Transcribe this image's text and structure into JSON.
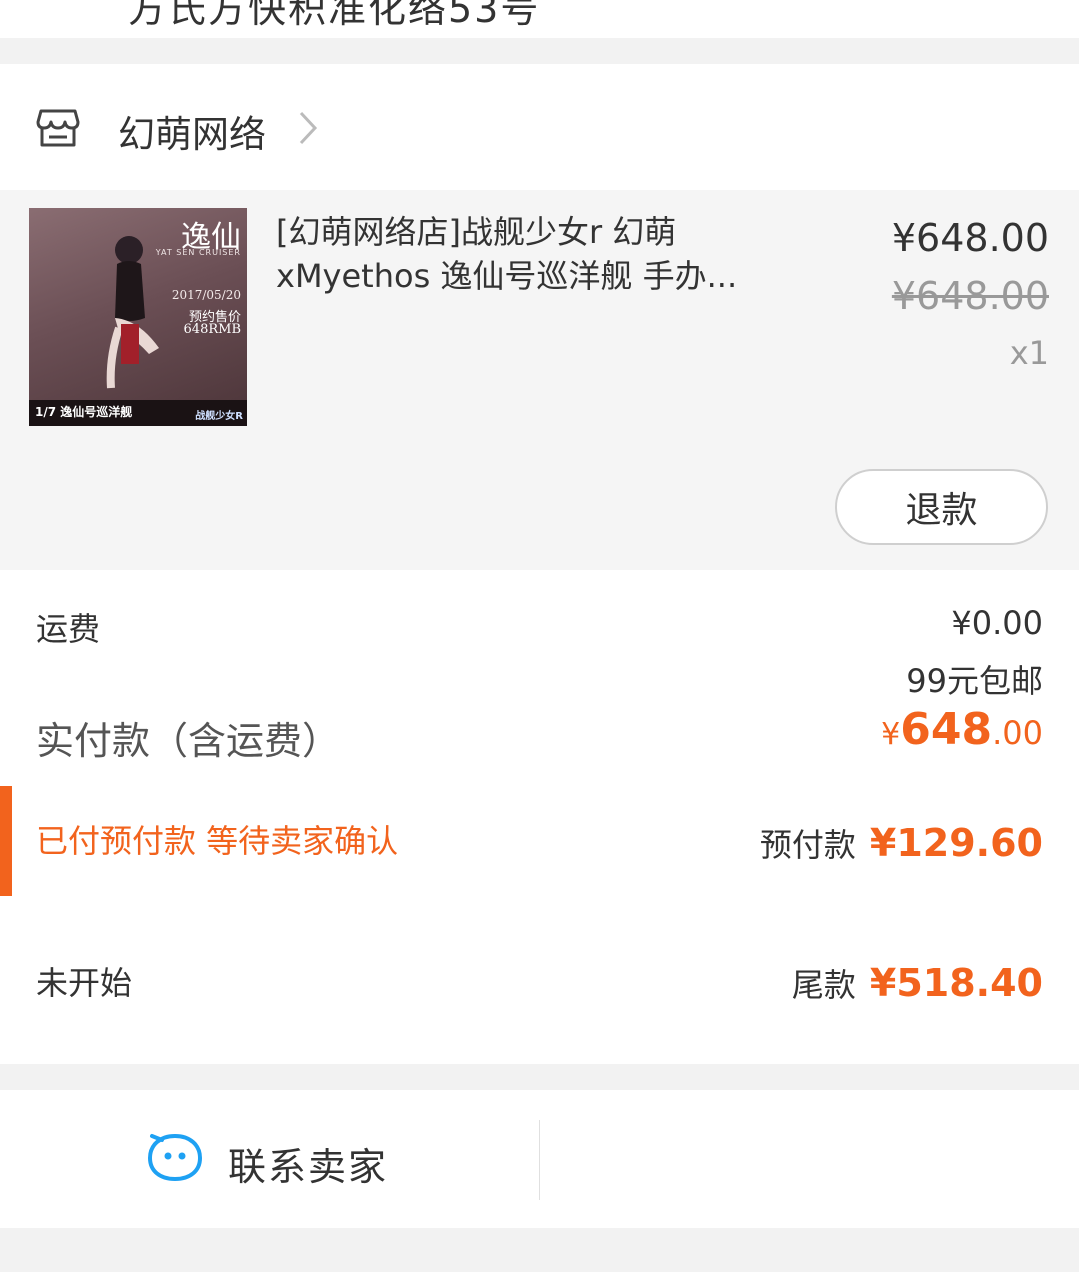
{
  "top_strip": {
    "partial_text": "方氏方快积准化络53号"
  },
  "shop": {
    "name": "幻萌网络",
    "icon": "store-icon",
    "chevron": "chevron-right-icon"
  },
  "product": {
    "title_line1": "[幻萌网络店]战舰少女r 幻萌",
    "title_line2": "xMyethos 逸仙号巡洋舰 手办...",
    "price": "¥648.00",
    "original_price": "¥648.00",
    "quantity": "x1",
    "thumbnail": {
      "title": "逸仙",
      "subtitle": "YAT SEN CRUISER",
      "date": "2017/05/20",
      "presale": "预约售价",
      "price": "648RMB",
      "caption": "1/7  逸仙号巡洋舰",
      "logo": "战舰少女R"
    },
    "refund_label": "退款"
  },
  "summary": {
    "shipping_label": "运费",
    "shipping_value": "¥0.00",
    "shipping_note": "99元包邮",
    "paid_label": "实付款（含运费）",
    "paid_currency": "¥",
    "paid_int": "648",
    "paid_dec": ".00",
    "status_text": "已付预付款 等待卖家确认",
    "deposit_label": "预付款",
    "deposit_value": "¥129.60",
    "balance_status": "未开始",
    "balance_label": "尾款",
    "balance_value": "¥518.40"
  },
  "contact": {
    "label": "联系卖家",
    "icon": "chat-icon"
  },
  "colors": {
    "accent": "#f2631d",
    "text": "#333333",
    "muted": "#999999",
    "background": "#f2f2f2",
    "chat_blue": "#1ea1f3"
  }
}
